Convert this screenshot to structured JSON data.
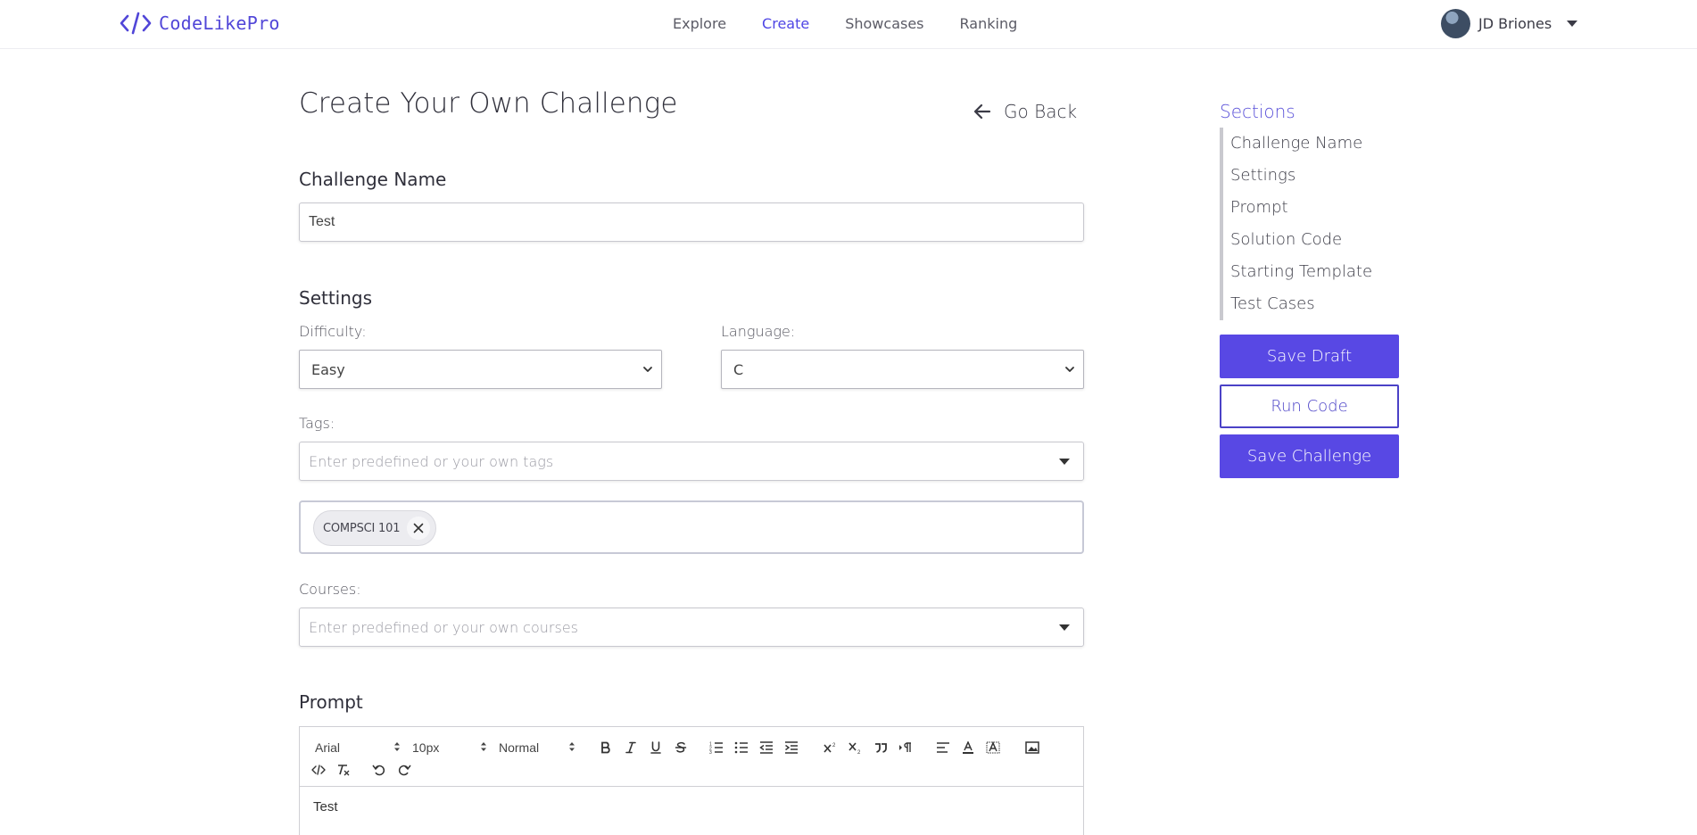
{
  "nav": {
    "brand": "CodeLikePro",
    "links": [
      "Explore",
      "Create",
      "Showcases",
      "Ranking"
    ],
    "active": "Create",
    "user_name": "JD Briones"
  },
  "page": {
    "title": "Create Your Own Challenge",
    "go_back": "Go Back"
  },
  "challenge_name": {
    "heading": "Challenge Name",
    "value": "Test"
  },
  "settings": {
    "heading": "Settings",
    "difficulty_label": "Difficulty:",
    "difficulty_value": "Easy",
    "language_label": "Language:",
    "language_value": "C",
    "tags_label": "Tags:",
    "tags_placeholder": "Enter predefined or your own tags",
    "selected_tags": [
      "COMPSCI 101"
    ],
    "courses_label": "Courses:",
    "courses_placeholder": "Enter predefined or your own courses"
  },
  "prompt": {
    "heading": "Prompt",
    "font_family": "Arial",
    "font_size": "10px",
    "block_format": "Normal",
    "content": "Test"
  },
  "sidebar": {
    "title": "Sections",
    "items": [
      "Challenge Name",
      "Settings",
      "Prompt",
      "Solution Code",
      "Starting Template",
      "Test Cases"
    ],
    "save_draft": "Save Draft",
    "run_code": "Run Code",
    "save_challenge": "Save Challenge"
  },
  "colors": {
    "accent": "#5848e4",
    "brand": "#5146d8"
  }
}
